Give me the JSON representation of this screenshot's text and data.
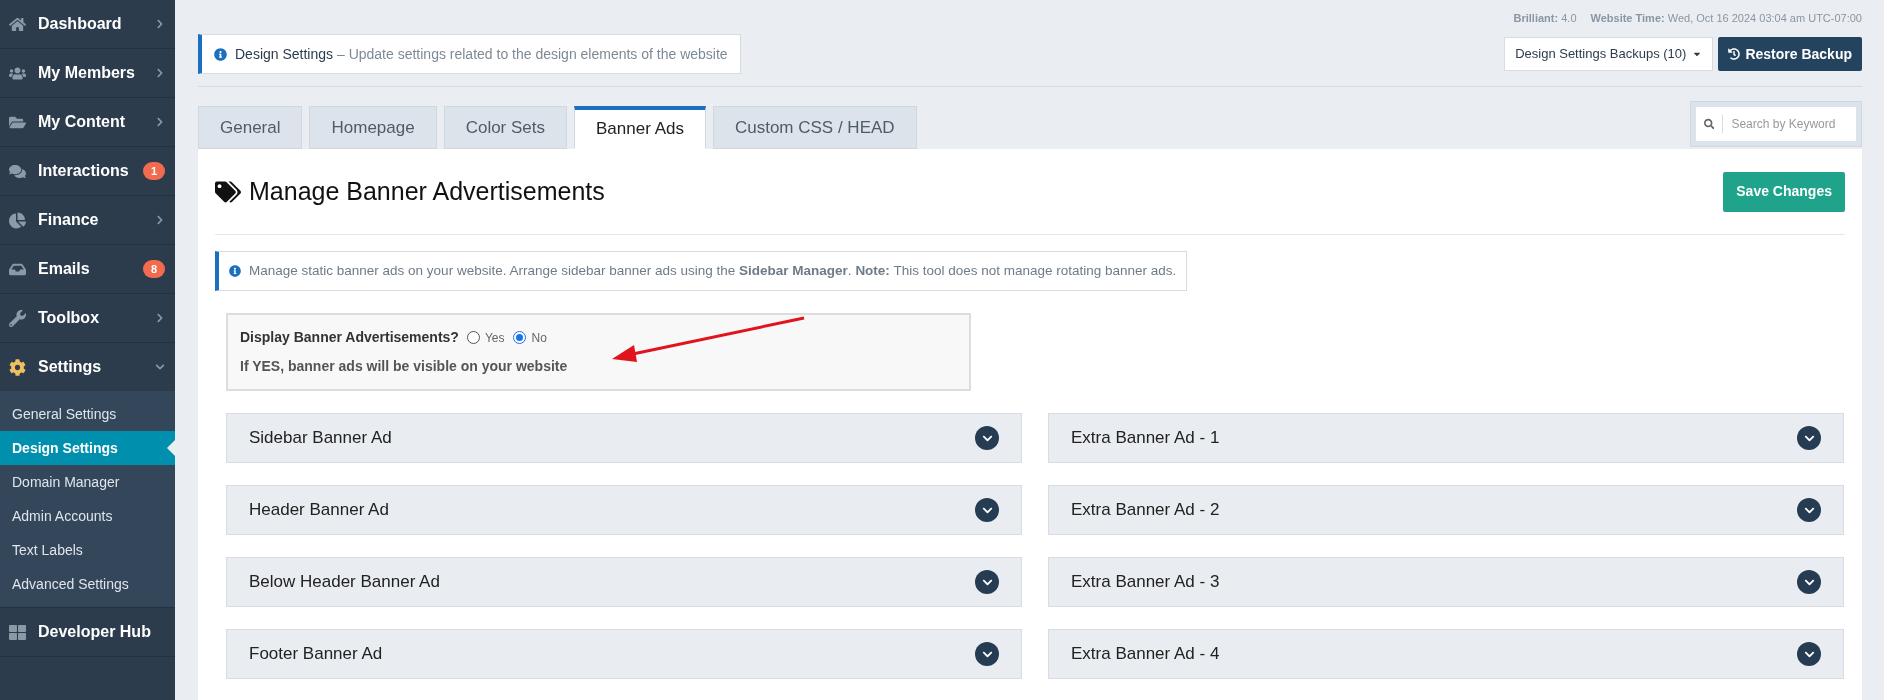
{
  "sidebar": {
    "items": [
      {
        "label": "Dashboard",
        "expanded": false
      },
      {
        "label": "My Members",
        "expanded": false
      },
      {
        "label": "My Content",
        "expanded": false
      },
      {
        "label": "Interactions",
        "badge": "1"
      },
      {
        "label": "Finance",
        "expanded": false
      },
      {
        "label": "Emails",
        "badge": "8"
      },
      {
        "label": "Toolbox",
        "expanded": false
      },
      {
        "label": "Settings",
        "expanded": true,
        "children": [
          {
            "label": "General Settings",
            "selected": false
          },
          {
            "label": "Design Settings",
            "selected": true
          },
          {
            "label": "Domain Manager",
            "selected": false
          },
          {
            "label": "Admin Accounts",
            "selected": false
          },
          {
            "label": "Text Labels",
            "selected": false
          },
          {
            "label": "Advanced Settings",
            "selected": false
          }
        ]
      },
      {
        "label": "Developer Hub"
      }
    ]
  },
  "meta": [
    {
      "label": "Brilliant:",
      "value": "4.0"
    },
    {
      "label": "Website Time:",
      "value": "Wed, Oct 16 2024 03:04 am UTC-07:00"
    }
  ],
  "page_info": {
    "title": "Design Settings",
    "description": "– Update settings related to the design elements of the website"
  },
  "backups_dropdown": "Design Settings Backups (10)",
  "restore_button": "Restore Backup",
  "tabs": [
    {
      "label": "General",
      "selected": false
    },
    {
      "label": "Homepage",
      "selected": false
    },
    {
      "label": "Color Sets",
      "selected": false
    },
    {
      "label": "Banner Ads",
      "selected": true
    },
    {
      "label": "Custom CSS / HEAD",
      "selected": false
    }
  ],
  "search": {
    "placeholder": "Search by Keyword"
  },
  "panel": {
    "title": "Manage Banner Advertisements",
    "save_button": "Save Changes",
    "note": "Manage static banner ads on your website. Arrange sidebar banner ads using the **Sidebar Manager**. **Note:** This tool does not manage rotating banner ads.",
    "display_question": {
      "label": "Display Banner Advertisements?",
      "options": [
        {
          "label": "Yes",
          "selected": false
        },
        {
          "label": "No",
          "selected": true
        }
      ],
      "hint": "If YES, banner ads will be visible on your website"
    },
    "accordions": [
      {
        "label": "Sidebar Banner Ad",
        "expanded": false
      },
      {
        "label": "Extra Banner Ad - 1",
        "expanded": false
      },
      {
        "label": "Header Banner Ad",
        "expanded": false
      },
      {
        "label": "Extra Banner Ad - 2",
        "expanded": false
      },
      {
        "label": "Below Header Banner Ad",
        "expanded": false
      },
      {
        "label": "Extra Banner Ad - 3",
        "expanded": false
      },
      {
        "label": "Footer Banner Ad",
        "expanded": false
      },
      {
        "label": "Extra Banner Ad - 4",
        "expanded": false
      }
    ]
  }
}
